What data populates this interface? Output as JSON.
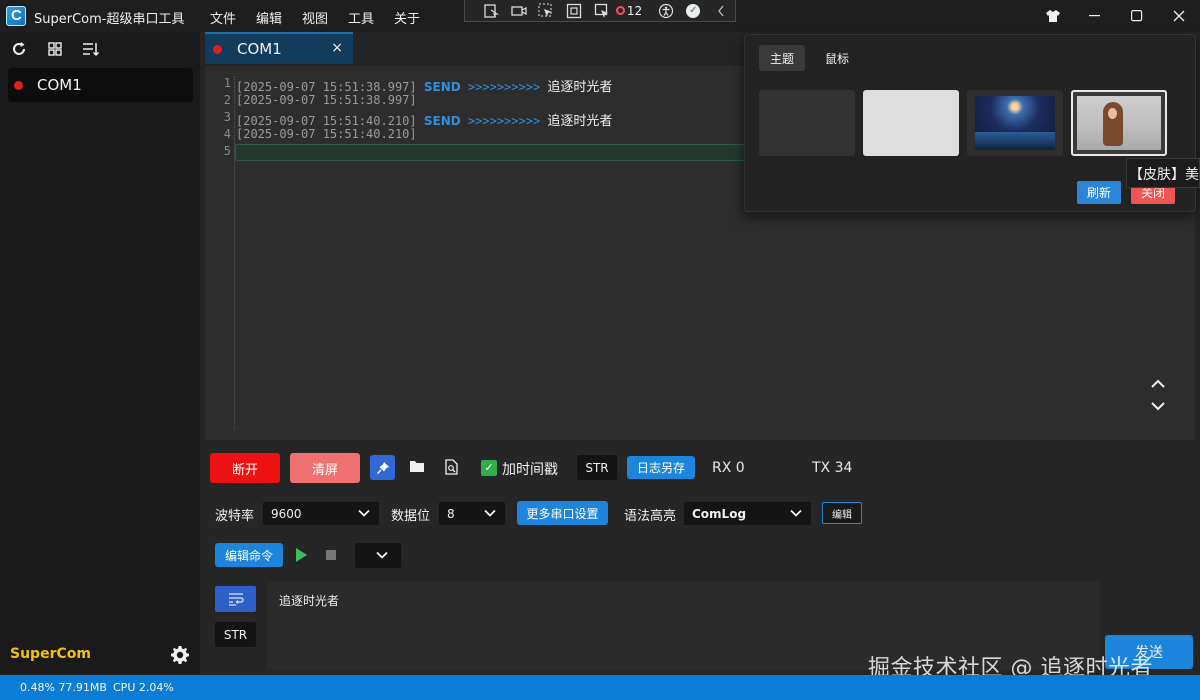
{
  "window": {
    "title": "SuperCom-超级串口工具",
    "menu": [
      "文件",
      "编辑",
      "视图",
      "工具",
      "关于"
    ],
    "toolstrip_device_count": "12"
  },
  "sidebar": {
    "port": "COM1",
    "brand": "SuperCom"
  },
  "tab": {
    "label": "COM1",
    "close": "×"
  },
  "log": {
    "line_numbers": [
      "1",
      "2",
      "3",
      "4",
      "5"
    ],
    "lines": [
      {
        "timestamp": "[2025-09-07 15:51:38.997]",
        "tag": "SEND",
        "arrows": ">>>>>>>>>>",
        "message": "追逐时光者"
      },
      {
        "timestamp": "[2025-09-07 15:51:38.997]",
        "tag": "",
        "arrows": "",
        "message": ""
      },
      {
        "timestamp": "[2025-09-07 15:51:40.210]",
        "tag": "SEND",
        "arrows": ">>>>>>>>>>",
        "message": "追逐时光者"
      },
      {
        "timestamp": "[2025-09-07 15:51:40.210]",
        "tag": "",
        "arrows": "",
        "message": ""
      },
      {
        "timestamp": "",
        "tag": "",
        "arrows": "",
        "message": ""
      }
    ]
  },
  "toolbar": {
    "disconnect": "断开",
    "clear": "清屏",
    "timestamp_label": "加时间戳",
    "timestamp_checked": true,
    "format": "STR",
    "save_log": "日志另存",
    "rx": "RX 0",
    "tx": "TX 34"
  },
  "settings": {
    "baud_label": "波特率",
    "baud_value": "9600",
    "databits_label": "数据位",
    "databits_value": "8",
    "more": "更多串口设置",
    "highlight_label": "语法高亮",
    "highlight_value": "ComLog",
    "edit": "编辑"
  },
  "command": {
    "edit_command": "编辑命令"
  },
  "input": {
    "text": "追逐时光者",
    "format": "STR",
    "send": "发送"
  },
  "status": {
    "memory": "0.48% 77.91MB",
    "cpu": "CPU 2.04%"
  },
  "theme_popup": {
    "tab_theme": "主题",
    "tab_mouse": "鼠标",
    "refresh": "刷新",
    "close": "关闭",
    "tooltip": "【皮肤】美"
  },
  "watermark": "掘金技术社区 @ 追逐时光者",
  "colors": {
    "accent": "#1d86dc",
    "danger": "#ee1111",
    "status_bar": "#0b7dd6",
    "brand": "#f3c20e"
  }
}
